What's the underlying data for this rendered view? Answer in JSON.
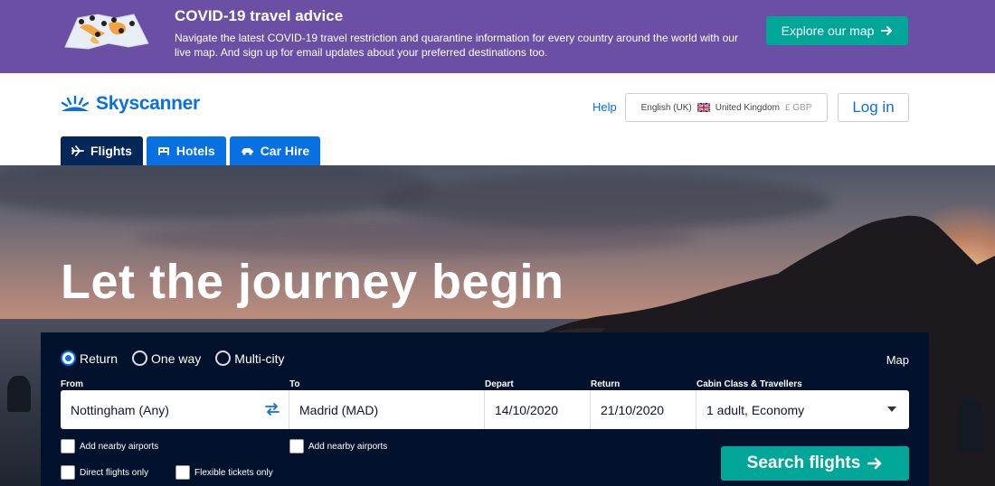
{
  "banner": {
    "title": "COVID-19 travel advice",
    "text": "Navigate the latest COVID-19 travel restriction and quarantine information for every country around the world with our live map. And sign up for email updates about your preferred destinations too.",
    "cta_label": "Explore our map",
    "cta_icon": "arrow-right-icon",
    "background_color": "#6b4fa5",
    "cta_color": "#00a698"
  },
  "header": {
    "logo_text": "Skyscanner",
    "help_label": "Help",
    "locale": {
      "language": "English (UK)",
      "country": "United Kingdom",
      "currency": "£ GBP"
    },
    "login_label": "Log in",
    "brand_color": "#0770e3"
  },
  "tabs": [
    {
      "label": "Flights",
      "icon": "plane-icon",
      "active": true
    },
    {
      "label": "Hotels",
      "icon": "bed-icon",
      "active": false
    },
    {
      "label": "Car Hire",
      "icon": "car-icon",
      "active": false
    }
  ],
  "hero": {
    "title": "Let the journey begin"
  },
  "search": {
    "trip_types": [
      {
        "label": "Return",
        "selected": true
      },
      {
        "label": "One way",
        "selected": false
      },
      {
        "label": "Multi-city",
        "selected": false
      }
    ],
    "map_label": "Map",
    "fields": {
      "from": {
        "label": "From",
        "value": "Nottingham (Any)"
      },
      "to": {
        "label": "To",
        "value": "Madrid (MAD)"
      },
      "depart": {
        "label": "Depart",
        "value": "14/10/2020"
      },
      "return": {
        "label": "Return",
        "value": "21/10/2020"
      },
      "cabin": {
        "label": "Cabin Class & Travellers",
        "value": "1 adult, Economy"
      }
    },
    "options": {
      "nearby_from": "Add nearby airports",
      "nearby_to": "Add nearby airports",
      "direct": "Direct flights only",
      "flexible": "Flexible tickets only"
    },
    "submit_label": "Search flights",
    "panel_color": "#02122c"
  }
}
